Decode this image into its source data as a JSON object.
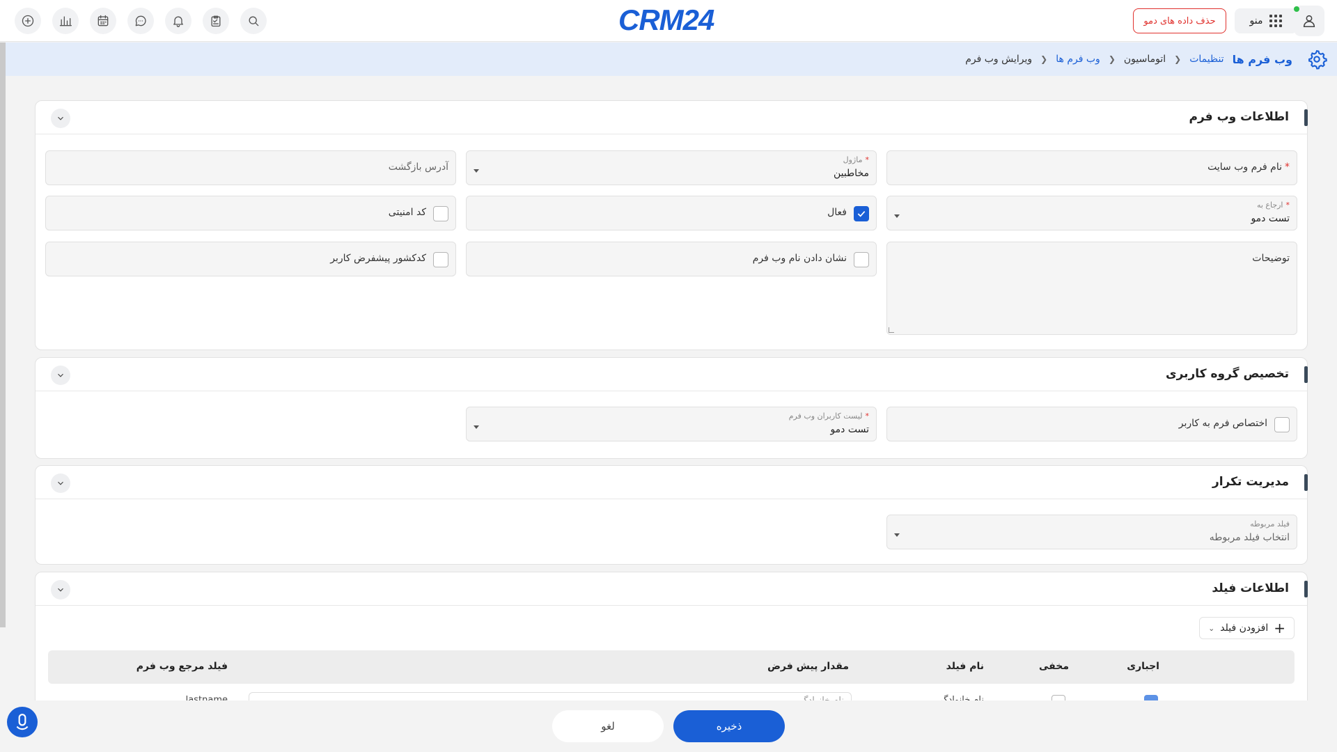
{
  "header": {
    "logo_crm": "CRM",
    "logo_num": "24",
    "demo_button": "حذف داده های دمو",
    "menu_label": "منو"
  },
  "breadcrumb": {
    "title": "وب فرم ها",
    "items": [
      "تنظیمات",
      "اتوماسیون",
      "وب فرم ها",
      "ویرایش وب فرم"
    ]
  },
  "webform_info": {
    "title": "اطلاعات وب فرم",
    "site_form_name_label": "نام فرم وب سایت",
    "module_label": "ماژول",
    "module_value": "مخاطبین",
    "return_address_placeholder": "آدرس بازگشت",
    "assign_to_label": "ارجاع به",
    "assign_to_value": "تست دمو",
    "active_label": "فعال",
    "active_checked": true,
    "security_code_label": "کد امنیتی",
    "description_label": "توضیحات",
    "show_name_label": "نشان دادن نام وب فرم",
    "default_country_label": "کدکشور پیشفرض کاربر"
  },
  "user_group": {
    "title": "تخصیص گروه کاربری",
    "assign_form_label": "اختصاص فرم به کاربر",
    "users_list_label": "لیست کاربران وب فرم",
    "users_list_value": "تست دمو"
  },
  "duplicate": {
    "title": "مدیریت تکرار",
    "related_field_label": "فیلد مربوطه",
    "related_field_placeholder": "انتخاب فیلد مربوطه"
  },
  "field_info": {
    "title": "اطلاعات فیلد",
    "add_field_button": "افزودن فیلد",
    "columns": {
      "mandatory": "اجباری",
      "hidden": "مخفی",
      "field_name": "نام فیلد",
      "default_value": "مقدار پیش فرض",
      "reference_field": "فیلد مرجع وب فرم"
    },
    "peek_row": {
      "field_name": "نام خانوادگی",
      "default_value": "نام خانوادگی",
      "reference_field": "lastname"
    }
  },
  "footer": {
    "save": "ذخیره",
    "cancel": "لغو"
  },
  "colors": {
    "brand": "#1a5fd6",
    "danger": "#e0312d",
    "crumb_bg": "#e3ecfa"
  }
}
